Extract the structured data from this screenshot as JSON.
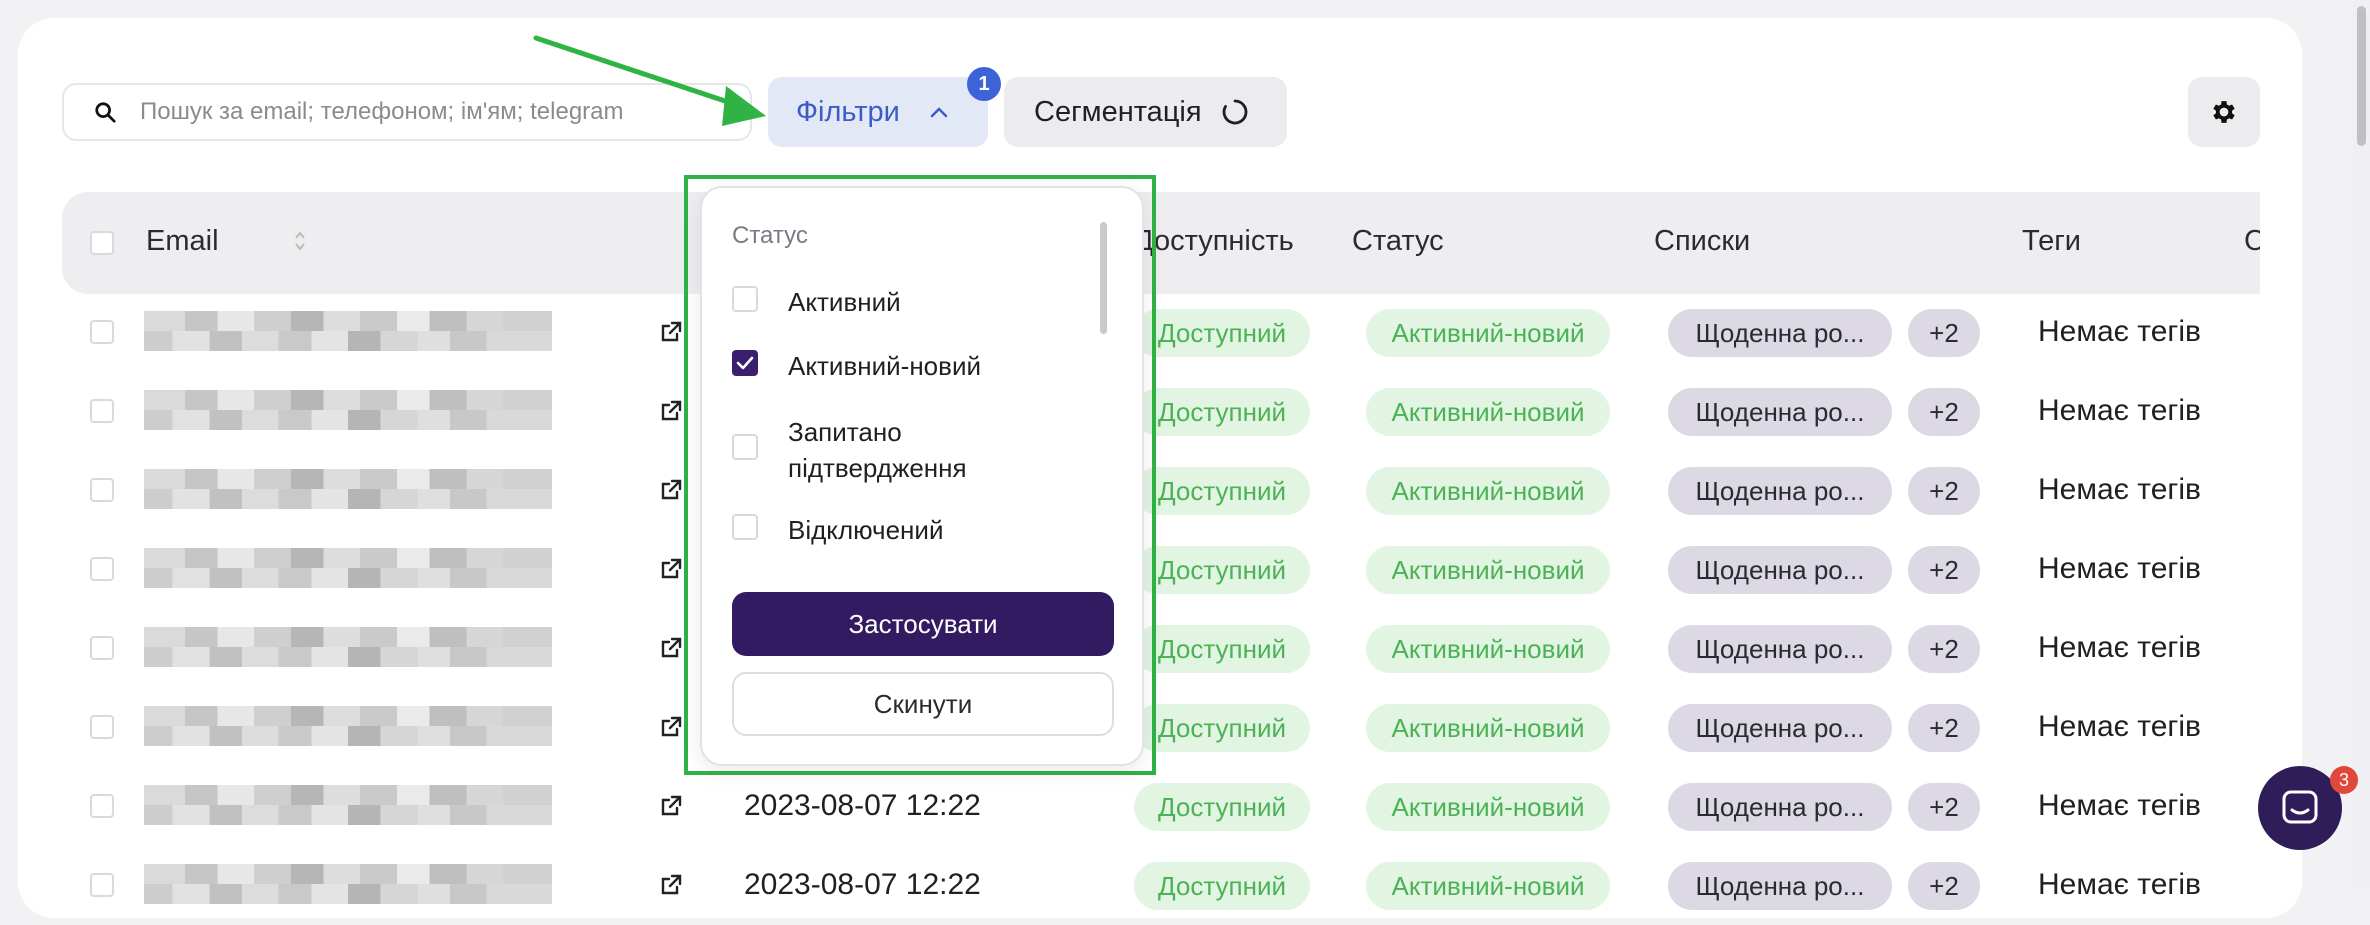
{
  "toolbar": {
    "search_placeholder": "Пошук за email; телефоном; ім'ям; telegram",
    "filters_label": "Фільтри",
    "filters_badge": "1",
    "segmentation_label": "Сегментація"
  },
  "table": {
    "columns": [
      "Email",
      "Доступність",
      "Статус",
      "Списки",
      "Теги",
      "С"
    ],
    "rows": [
      {
        "date": "",
        "availability": "Доступний",
        "status": "Активний-новий",
        "list": "Щоденна ро...",
        "more": "+2",
        "tags": "Немає тегів"
      },
      {
        "date": "",
        "availability": "Доступний",
        "status": "Активний-новий",
        "list": "Щоденна ро...",
        "more": "+2",
        "tags": "Немає тегів"
      },
      {
        "date": "",
        "availability": "Доступний",
        "status": "Активний-новий",
        "list": "Щоденна ро...",
        "more": "+2",
        "tags": "Немає тегів"
      },
      {
        "date": "",
        "availability": "Доступний",
        "status": "Активний-новий",
        "list": "Щоденна ро...",
        "more": "+2",
        "tags": "Немає тегів"
      },
      {
        "date": "",
        "availability": "Доступний",
        "status": "Активний-новий",
        "list": "Щоденна ро...",
        "more": "+2",
        "tags": "Немає тегів"
      },
      {
        "date": "",
        "availability": "Доступний",
        "status": "Активний-новий",
        "list": "Щоденна ро...",
        "more": "+2",
        "tags": "Немає тегів"
      },
      {
        "date": "2023-08-07 12:22",
        "availability": "Доступний",
        "status": "Активний-новий",
        "list": "Щоденна ро...",
        "more": "+2",
        "tags": "Немає тегів"
      },
      {
        "date": "2023-08-07 12:22",
        "availability": "Доступний",
        "status": "Активний-новий",
        "list": "Щоденна ро...",
        "more": "+2",
        "tags": "Немає тегів"
      }
    ]
  },
  "filter_popup": {
    "title": "Статус",
    "options": [
      {
        "label": "Активний",
        "checked": false
      },
      {
        "label": "Активний-новий",
        "checked": true
      },
      {
        "label": "Запитано підтвердження",
        "checked": false
      },
      {
        "label": "Відключений",
        "checked": false
      }
    ],
    "apply_label": "Застосувати",
    "reset_label": "Скинути"
  },
  "chat": {
    "badge": "3"
  },
  "colors": {
    "accent": "#3d5cc7",
    "primary_dark": "#331b62",
    "success_text": "#4bb256",
    "success_bg": "#e2f4e2",
    "highlight_frame": "#2fb344"
  }
}
